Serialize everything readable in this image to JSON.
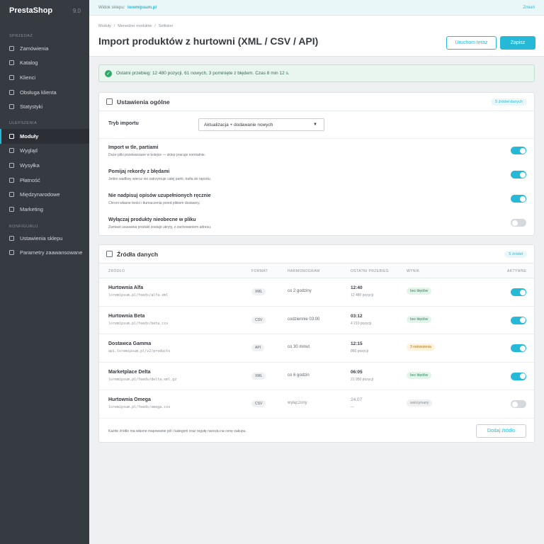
{
  "app": {
    "logo": "PrestaShop",
    "version": "9.0"
  },
  "sidebar": {
    "sections": [
      {
        "label": "SPRZEDAŻ",
        "items": [
          {
            "label": "Zamówienia"
          },
          {
            "label": "Katalog"
          },
          {
            "label": "Klienci"
          },
          {
            "label": "Obsługa klienta"
          },
          {
            "label": "Statystyki"
          }
        ]
      },
      {
        "label": "ULEPSZENIA",
        "items": [
          {
            "label": "Moduły",
            "active": true
          },
          {
            "label": "Wygląd"
          },
          {
            "label": "Wysyłka"
          },
          {
            "label": "Płatność"
          },
          {
            "label": "Międzynarodowe"
          },
          {
            "label": "Marketing"
          }
        ]
      },
      {
        "label": "KONFIGURUJ",
        "items": [
          {
            "label": "Ustawienia sklepu"
          },
          {
            "label": "Parametry zaawansowane"
          }
        ]
      }
    ]
  },
  "topbar": {
    "shop_label": "Widok sklepu:",
    "shop_link": "loremipsum.pl",
    "change": "Zmień"
  },
  "header": {
    "breadcrumb": [
      "Moduły",
      "/",
      "Menedżer modułów",
      "/",
      "Sellision"
    ],
    "title": "Import produktów z hurtowni (XML / CSV / API)",
    "run_now": "Uruchom teraz",
    "save": "Zapisz"
  },
  "alert": {
    "text": "Ostatni przebieg: 12 480 pozycji, 61 nowych, 3 pominięte z błędem. Czas 8 min 12 s."
  },
  "general": {
    "title": "Ustawienia ogólne",
    "badge": "5 źródeł danych",
    "mode_label": "Tryb importu",
    "mode_value": "Aktualizacja + dodawanie nowych",
    "options": [
      {
        "title": "Import w tle, partiami",
        "desc": "Duże pliki przetwarzane w kolejce — sklep pracuje normalnie.",
        "on": true
      },
      {
        "title": "Pomijaj rekordy z błędami",
        "desc": "Jeden wadliwy wiersz nie zatrzymuje całej partii, trafia do raportu.",
        "on": true
      },
      {
        "title": "Nie nadpisuj opisów uzupełnionych ręcznie",
        "desc": "Chroni własne treści i tłumaczenia przed plikiem dostawcy.",
        "on": true
      },
      {
        "title": "Wyłączaj produkty nieobecne w pliku",
        "desc": "Zamiast usuwania produkt zostaje ukryty, z zachowaniem adresu.",
        "on": false
      }
    ]
  },
  "sources": {
    "title": "Źródła danych",
    "badge": "5 źródeł",
    "columns": [
      "ŹRÓDŁO",
      "FORMAT",
      "HARMONOGRAM",
      "OSTATNI PRZEBIEG",
      "WYNIK",
      "AKTYWNE"
    ],
    "rows": [
      {
        "name": "Hurtownia Alfa",
        "url": "loremipsum.pl/feeds/alfa.xml",
        "format": "XML",
        "schedule": "co 2 godziny",
        "last": "12:40",
        "count": "12 480 pozycji",
        "result": "bez błędów",
        "status": "ok",
        "active": true
      },
      {
        "name": "Hurtownia Beta",
        "url": "loremipsum.pl/feeds/beta.csv",
        "format": "CSV",
        "schedule": "codziennie 03:00",
        "last": "03:12",
        "count": "4 210 pozycji",
        "result": "bez błędów",
        "status": "ok",
        "active": true
      },
      {
        "name": "Dostawca Gamma",
        "url": "api.loremipsum.pl/v2/products",
        "format": "API",
        "schedule": "co 30 minut",
        "last": "12:15",
        "count": "860 pozycji",
        "result": "3 ostrzeżenia",
        "status": "warn",
        "active": true
      },
      {
        "name": "Marketplace Delta",
        "url": "loremipsum.pl/feeds/delta.xml.gz",
        "format": "XML",
        "schedule": "co 6 godzin",
        "last": "06:05",
        "count": "21 950 pozycji",
        "result": "bez błędów",
        "status": "ok",
        "active": true
      },
      {
        "name": "Hurtownia Omega",
        "url": "loremipsum.pl/feeds/omega.csv",
        "format": "CSV",
        "schedule": "wyłączony",
        "last": "24.07",
        "count": "—",
        "result": "wstrzymany",
        "status": "stop",
        "active": false
      }
    ],
    "footer_note": "Każde źródło ma własne mapowanie pól i kategorii oraz regułę narzutu na cenę zakupu.",
    "add_button": "Dodaj źródło"
  }
}
